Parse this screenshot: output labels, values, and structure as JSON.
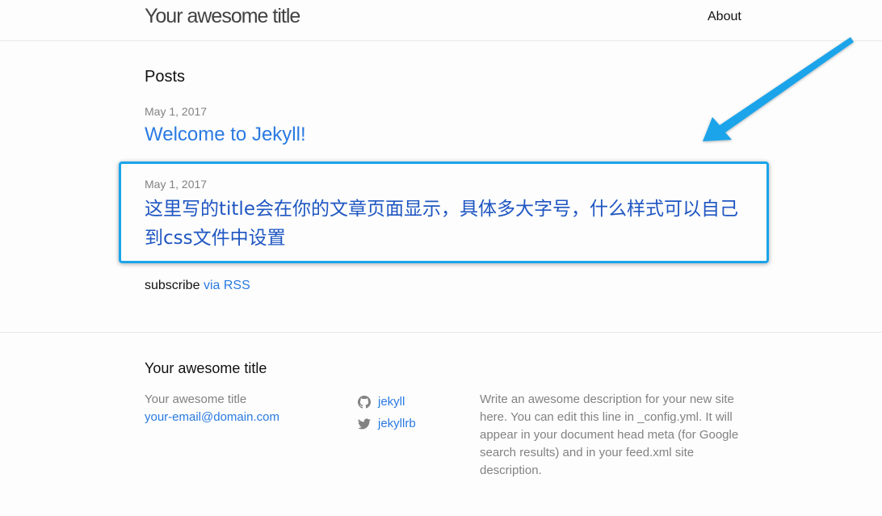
{
  "header": {
    "site_title": "Your awesome title",
    "nav_about": "About"
  },
  "main": {
    "posts_heading": "Posts",
    "posts": [
      {
        "date": "May 1, 2017",
        "title": "Welcome to Jekyll!"
      },
      {
        "date": "May 1, 2017",
        "title": "这里写的title会在你的文章页面显示，具体多大字号，什么样式可以自己到css文件中设置"
      }
    ],
    "subscribe_text": "subscribe",
    "rss_link": "via RSS"
  },
  "footer": {
    "heading": "Your awesome title",
    "name": "Your awesome title",
    "email": "your-email@domain.com",
    "github_username": "jekyll",
    "twitter_username": "jekyllrb",
    "description": "Write an awesome description for your new site here. You can edit this line in _config.yml. It will appear in your document head meta (for Google search results) and in your feed.xml site description."
  },
  "colors": {
    "link": "#2a7ae2",
    "highlight_border": "#1aa4ea",
    "arrow": "#1aa4ea",
    "meta_text": "#828282"
  },
  "icons": [
    "github-icon",
    "twitter-icon",
    "arrow-annotation"
  ]
}
